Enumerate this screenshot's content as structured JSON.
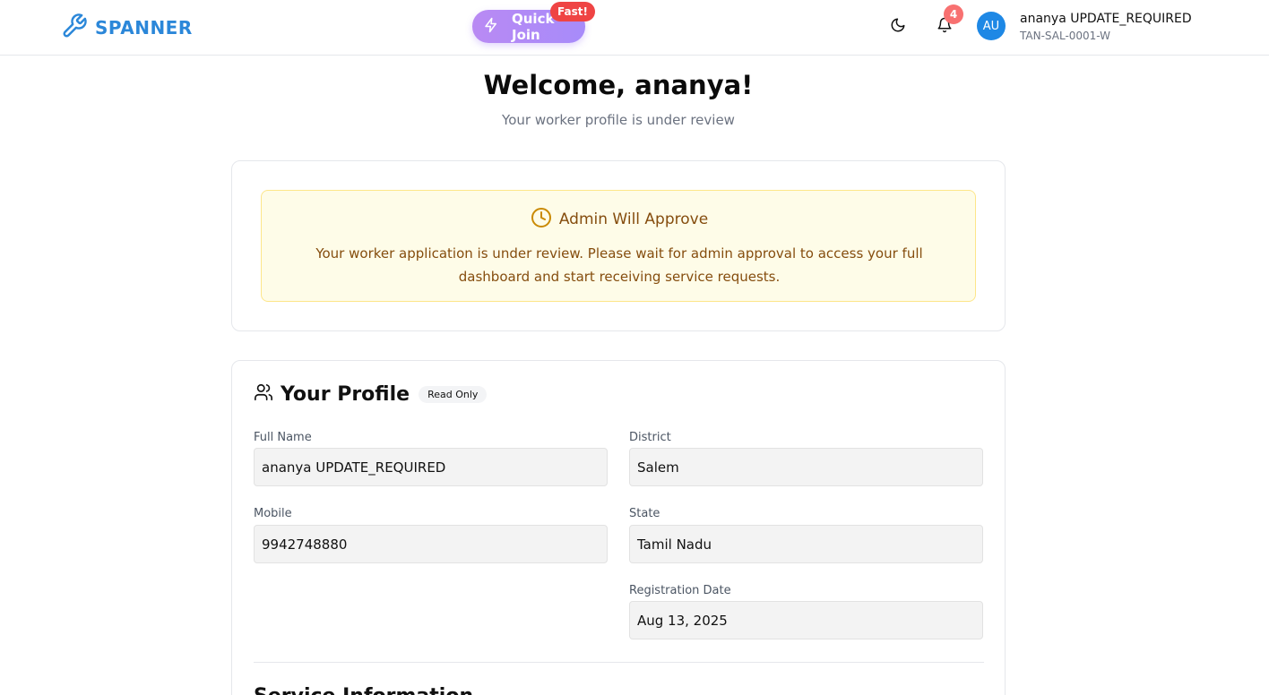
{
  "header": {
    "brand": "SPANNER",
    "quick_join_label": "Quick Join",
    "fast_badge": "Fast!",
    "notification_count": "4",
    "avatar_initials": "AU",
    "user_name": "ananya UPDATE_REQUIRED",
    "user_id": "TAN-SAL-0001-W",
    "brand_color": "#2b87d9"
  },
  "welcome": {
    "title": "Welcome, ananya!",
    "subtitle": "Your worker profile is under review"
  },
  "approval": {
    "title": "Admin Will Approve",
    "message": "Your worker application is under review. Please wait for admin approval to access your full dashboard and start receiving service requests."
  },
  "profile": {
    "title": "Your Profile",
    "badge": "Read Only",
    "fields": {
      "full_name": {
        "label": "Full Name",
        "value": "ananya UPDATE_REQUIRED"
      },
      "district": {
        "label": "District",
        "value": "Salem"
      },
      "mobile": {
        "label": "Mobile",
        "value": "9942748880"
      },
      "state": {
        "label": "State",
        "value": "Tamil Nadu"
      },
      "registration_date": {
        "label": "Registration Date",
        "value": "Aug 13, 2025"
      }
    },
    "next_section_title": "Service Information"
  },
  "icons": [
    "wrench-icon",
    "lightning-icon",
    "moon-icon",
    "bell-icon",
    "clock-icon",
    "users-icon"
  ]
}
